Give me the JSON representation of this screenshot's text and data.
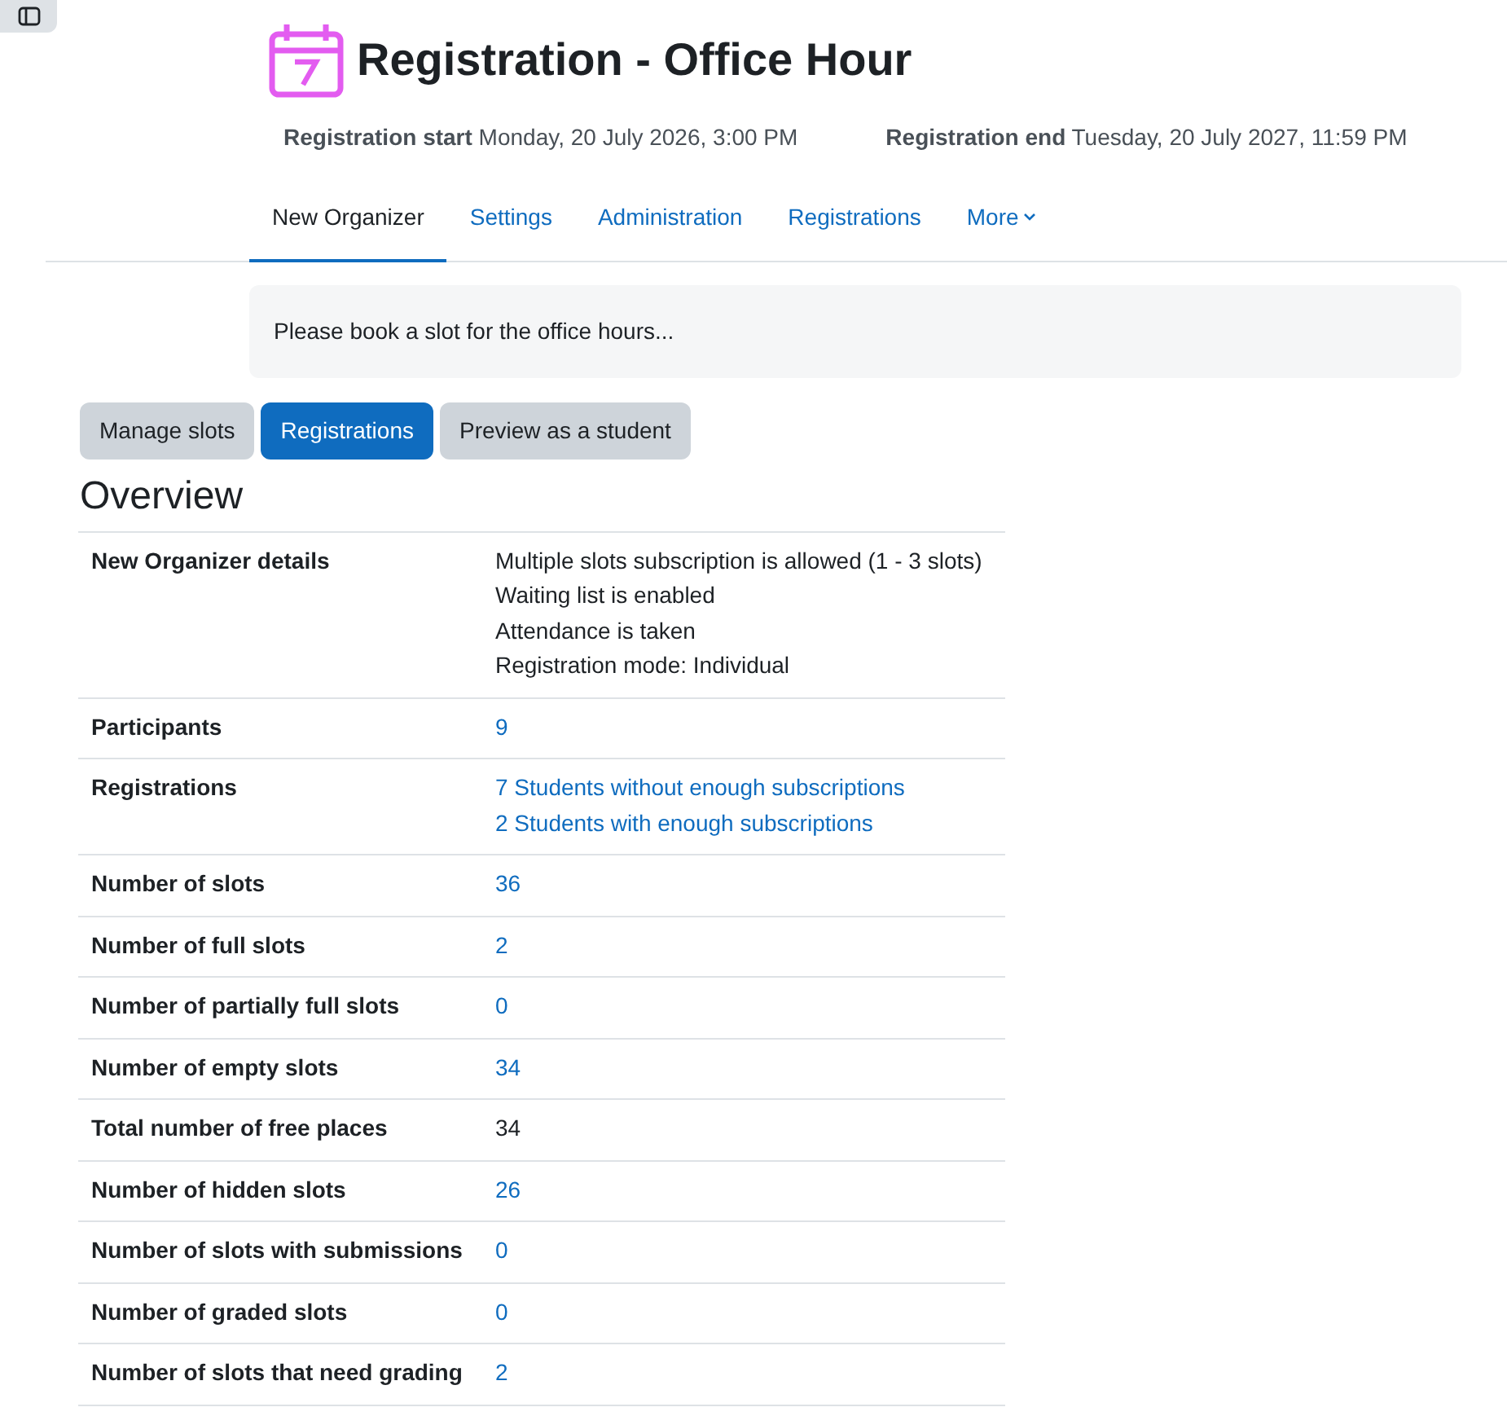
{
  "title": "Registration - Office Hour",
  "dates": [
    {
      "label": "Registration start",
      "value": "Monday, 20 July 2026, 3:00 PM"
    },
    {
      "label": "Registration end",
      "value": "Tuesday, 20 July 2027, 11:59 PM"
    }
  ],
  "tabs": [
    {
      "label": "New Organizer",
      "selected": true
    },
    {
      "label": "Settings",
      "selected": false
    },
    {
      "label": "Administration",
      "selected": false
    },
    {
      "label": "Registrations",
      "selected": false
    },
    {
      "label": "More",
      "selected": false,
      "kind": "dropdown"
    }
  ],
  "intro": "Please book a slot for the office hours...",
  "view_buttons": [
    {
      "label": "Manage slots",
      "selected": false
    },
    {
      "label": "Registrations",
      "selected": true
    },
    {
      "label": "Preview as a student",
      "selected": false
    }
  ],
  "heading": "Overview",
  "rows": [
    {
      "label": "New Organizer details",
      "values": [
        {
          "text": "Multiple slots subscription is allowed (1 - 3 slots)",
          "kind": "text"
        },
        {
          "text": "Waiting list is enabled",
          "kind": "text"
        },
        {
          "text": "Attendance is taken",
          "kind": "text"
        },
        {
          "text": "Registration mode: Individual",
          "kind": "text"
        }
      ]
    },
    {
      "label": "Participants",
      "values": [
        {
          "text": "9",
          "kind": "link"
        }
      ]
    },
    {
      "label": "Registrations",
      "values": [
        {
          "text": "7 Students without enough subscriptions",
          "kind": "link"
        },
        {
          "text": "2 Students with enough subscriptions",
          "kind": "link"
        }
      ]
    },
    {
      "label": "Number of slots",
      "values": [
        {
          "text": "36",
          "kind": "link"
        }
      ]
    },
    {
      "label": "Number of full slots",
      "values": [
        {
          "text": "2",
          "kind": "link"
        }
      ]
    },
    {
      "label": "Number of partially full slots",
      "values": [
        {
          "text": "0",
          "kind": "link"
        }
      ]
    },
    {
      "label": "Number of empty slots",
      "values": [
        {
          "text": "34",
          "kind": "link"
        }
      ]
    },
    {
      "label": "Total number of free places",
      "values": [
        {
          "text": "34",
          "kind": "text"
        }
      ]
    },
    {
      "label": "Number of hidden slots",
      "values": [
        {
          "text": "26",
          "kind": "link"
        }
      ]
    },
    {
      "label": "Number of slots with submissions",
      "values": [
        {
          "text": "0",
          "kind": "link"
        }
      ]
    },
    {
      "label": "Number of graded slots",
      "values": [
        {
          "text": "0",
          "kind": "link"
        }
      ]
    },
    {
      "label": "Number of slots that need grading",
      "values": [
        {
          "text": "2",
          "kind": "link"
        }
      ]
    }
  ]
}
